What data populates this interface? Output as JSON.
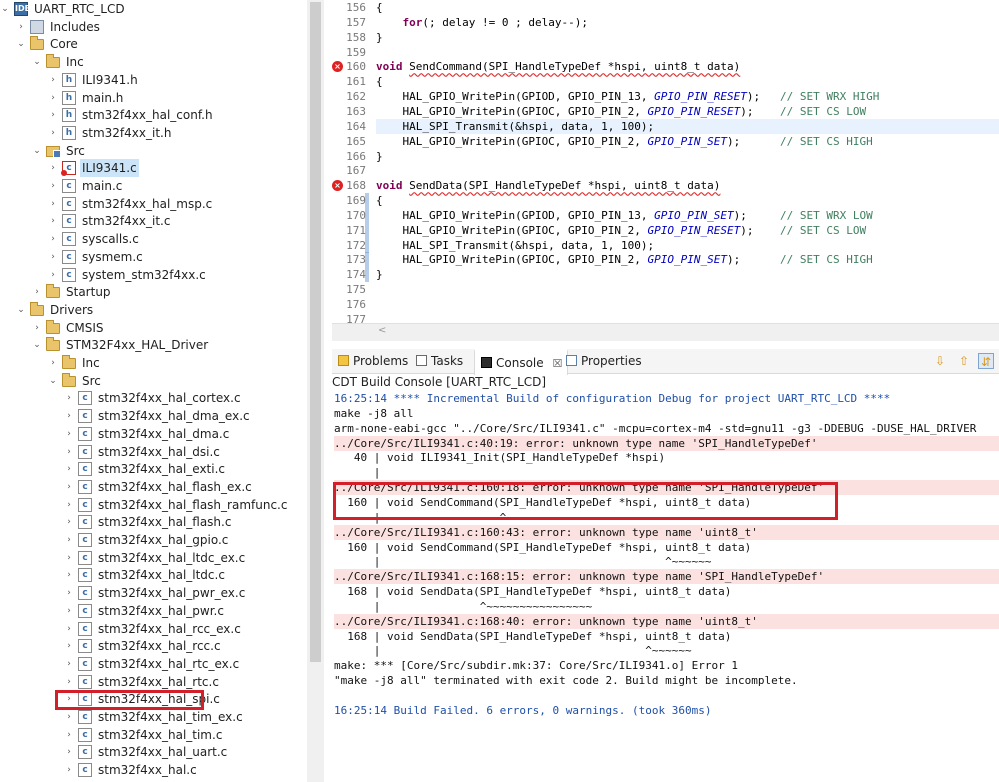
{
  "explorer": {
    "items": [
      {
        "label": "UART_RTC_LCD",
        "depth": 0,
        "twisty": "open",
        "icon": "project-icon"
      },
      {
        "label": "Includes",
        "depth": 1,
        "twisty": "closed",
        "icon": "includes-icon"
      },
      {
        "label": "Core",
        "depth": 1,
        "twisty": "open",
        "icon": "folder-icon"
      },
      {
        "label": "Inc",
        "depth": 2,
        "twisty": "open",
        "icon": "folder-icon"
      },
      {
        "label": "ILI9341.h",
        "depth": 3,
        "twisty": "closed",
        "icon": "h-file-icon"
      },
      {
        "label": "main.h",
        "depth": 3,
        "twisty": "closed",
        "icon": "h-file-icon"
      },
      {
        "label": "stm32f4xx_hal_conf.h",
        "depth": 3,
        "twisty": "closed",
        "icon": "h-file-icon"
      },
      {
        "label": "stm32f4xx_it.h",
        "depth": 3,
        "twisty": "closed",
        "icon": "h-file-icon"
      },
      {
        "label": "Src",
        "depth": 2,
        "twisty": "open",
        "icon": "source-folder-icon"
      },
      {
        "label": "ILI9341.c",
        "depth": 3,
        "twisty": "closed",
        "icon": "c-file-error-icon",
        "selected": true
      },
      {
        "label": "main.c",
        "depth": 3,
        "twisty": "closed",
        "icon": "c-file-icon"
      },
      {
        "label": "stm32f4xx_hal_msp.c",
        "depth": 3,
        "twisty": "closed",
        "icon": "c-file-icon"
      },
      {
        "label": "stm32f4xx_it.c",
        "depth": 3,
        "twisty": "closed",
        "icon": "c-file-icon"
      },
      {
        "label": "syscalls.c",
        "depth": 3,
        "twisty": "closed",
        "icon": "c-file-icon"
      },
      {
        "label": "sysmem.c",
        "depth": 3,
        "twisty": "closed",
        "icon": "c-file-icon"
      },
      {
        "label": "system_stm32f4xx.c",
        "depth": 3,
        "twisty": "closed",
        "icon": "c-file-icon"
      },
      {
        "label": "Startup",
        "depth": 2,
        "twisty": "closed",
        "icon": "folder-icon"
      },
      {
        "label": "Drivers",
        "depth": 1,
        "twisty": "open",
        "icon": "folder-icon"
      },
      {
        "label": "CMSIS",
        "depth": 2,
        "twisty": "closed",
        "icon": "folder-icon"
      },
      {
        "label": "STM32F4xx_HAL_Driver",
        "depth": 2,
        "twisty": "open",
        "icon": "folder-icon"
      },
      {
        "label": "Inc",
        "depth": 3,
        "twisty": "closed",
        "icon": "folder-icon"
      },
      {
        "label": "Src",
        "depth": 3,
        "twisty": "open",
        "icon": "folder-icon"
      },
      {
        "label": "stm32f4xx_hal_cortex.c",
        "depth": 4,
        "twisty": "closed",
        "icon": "c-file-icon"
      },
      {
        "label": "stm32f4xx_hal_dma_ex.c",
        "depth": 4,
        "twisty": "closed",
        "icon": "c-file-icon"
      },
      {
        "label": "stm32f4xx_hal_dma.c",
        "depth": 4,
        "twisty": "closed",
        "icon": "c-file-icon"
      },
      {
        "label": "stm32f4xx_hal_dsi.c",
        "depth": 4,
        "twisty": "closed",
        "icon": "c-file-icon"
      },
      {
        "label": "stm32f4xx_hal_exti.c",
        "depth": 4,
        "twisty": "closed",
        "icon": "c-file-icon"
      },
      {
        "label": "stm32f4xx_hal_flash_ex.c",
        "depth": 4,
        "twisty": "closed",
        "icon": "c-file-icon"
      },
      {
        "label": "stm32f4xx_hal_flash_ramfunc.c",
        "depth": 4,
        "twisty": "closed",
        "icon": "c-file-icon"
      },
      {
        "label": "stm32f4xx_hal_flash.c",
        "depth": 4,
        "twisty": "closed",
        "icon": "c-file-icon"
      },
      {
        "label": "stm32f4xx_hal_gpio.c",
        "depth": 4,
        "twisty": "closed",
        "icon": "c-file-icon"
      },
      {
        "label": "stm32f4xx_hal_ltdc_ex.c",
        "depth": 4,
        "twisty": "closed",
        "icon": "c-file-icon"
      },
      {
        "label": "stm32f4xx_hal_ltdc.c",
        "depth": 4,
        "twisty": "closed",
        "icon": "c-file-icon"
      },
      {
        "label": "stm32f4xx_hal_pwr_ex.c",
        "depth": 4,
        "twisty": "closed",
        "icon": "c-file-icon"
      },
      {
        "label": "stm32f4xx_hal_pwr.c",
        "depth": 4,
        "twisty": "closed",
        "icon": "c-file-icon"
      },
      {
        "label": "stm32f4xx_hal_rcc_ex.c",
        "depth": 4,
        "twisty": "closed",
        "icon": "c-file-icon"
      },
      {
        "label": "stm32f4xx_hal_rcc.c",
        "depth": 4,
        "twisty": "closed",
        "icon": "c-file-icon"
      },
      {
        "label": "stm32f4xx_hal_rtc_ex.c",
        "depth": 4,
        "twisty": "closed",
        "icon": "c-file-icon"
      },
      {
        "label": "stm32f4xx_hal_rtc.c",
        "depth": 4,
        "twisty": "closed",
        "icon": "c-file-icon"
      },
      {
        "label": "stm32f4xx_hal_spi.c",
        "depth": 4,
        "twisty": "closed",
        "icon": "c-file-icon",
        "highlighted": true
      },
      {
        "label": "stm32f4xx_hal_tim_ex.c",
        "depth": 4,
        "twisty": "closed",
        "icon": "c-file-icon"
      },
      {
        "label": "stm32f4xx_hal_tim.c",
        "depth": 4,
        "twisty": "closed",
        "icon": "c-file-icon"
      },
      {
        "label": "stm32f4xx_hal_uart.c",
        "depth": 4,
        "twisty": "closed",
        "icon": "c-file-icon"
      },
      {
        "label": "stm32f4xx_hal.c",
        "depth": 4,
        "twisty": "closed",
        "icon": "c-file-icon"
      }
    ]
  },
  "editor": {
    "lines": [
      {
        "n": "156",
        "code": [
          [
            "",
            "{"
          ]
        ]
      },
      {
        "n": "157",
        "code": [
          [
            "",
            "    "
          ],
          [
            "kw",
            "for"
          ],
          [
            "",
            "(; delay != 0 ; delay--);"
          ]
        ]
      },
      {
        "n": "158",
        "code": [
          [
            "",
            "}"
          ]
        ]
      },
      {
        "n": "159",
        "code": [
          [
            "",
            ""
          ]
        ]
      },
      {
        "n": "160",
        "marker": "error",
        "code": [
          [
            "kw",
            "void"
          ],
          [
            "",
            " "
          ],
          [
            "sq",
            "SendCommand(SPI_HandleTypeDef *hspi, uint8_t data)"
          ]
        ]
      },
      {
        "n": "161",
        "code": [
          [
            "",
            "{"
          ]
        ]
      },
      {
        "n": "162",
        "code": [
          [
            "",
            "    HAL_GPIO_WritePin(GPIOD, GPIO_PIN_13, "
          ],
          [
            "it",
            "GPIO_PIN_RESET"
          ],
          [
            "",
            "); "
          ],
          [
            "cm",
            "  // SET WRX HIGH"
          ]
        ]
      },
      {
        "n": "163",
        "code": [
          [
            "",
            "    HAL_GPIO_WritePin(GPIOC, GPIO_PIN_2, "
          ],
          [
            "it",
            "GPIO_PIN_RESET"
          ],
          [
            "",
            ");  "
          ],
          [
            "cm",
            "  // SET CS LOW"
          ]
        ]
      },
      {
        "n": "164",
        "current": true,
        "code": [
          [
            "",
            "    HAL_SPI_Transmit(&hspi, data, 1, 100);"
          ]
        ]
      },
      {
        "n": "165",
        "code": [
          [
            "",
            "    HAL_GPIO_WritePin(GPIOC, GPIO_PIN_2, "
          ],
          [
            "it",
            "GPIO_PIN_SET"
          ],
          [
            "",
            ");    "
          ],
          [
            "cm",
            "  // SET CS HIGH"
          ]
        ]
      },
      {
        "n": "166",
        "code": [
          [
            "",
            "}"
          ]
        ]
      },
      {
        "n": "167",
        "code": [
          [
            "",
            ""
          ]
        ]
      },
      {
        "n": "168",
        "marker": "error",
        "code": [
          [
            "kw",
            "void"
          ],
          [
            "",
            " "
          ],
          [
            "sq",
            "SendData(SPI_HandleTypeDef *hspi, uint8_t data)"
          ]
        ]
      },
      {
        "n": "169",
        "occ": true,
        "code": [
          [
            "",
            "{"
          ]
        ]
      },
      {
        "n": "170",
        "occ": true,
        "code": [
          [
            "",
            "    HAL_GPIO_WritePin(GPIOD, GPIO_PIN_13, "
          ],
          [
            "it",
            "GPIO_PIN_SET"
          ],
          [
            "",
            ");   "
          ],
          [
            "cm",
            "  // SET WRX LOW"
          ]
        ]
      },
      {
        "n": "171",
        "occ": true,
        "code": [
          [
            "",
            "    HAL_GPIO_WritePin(GPIOC, GPIO_PIN_2, "
          ],
          [
            "it",
            "GPIO_PIN_RESET"
          ],
          [
            "",
            ");  "
          ],
          [
            "cm",
            "  // SET CS LOW"
          ]
        ]
      },
      {
        "n": "172",
        "occ": true,
        "code": [
          [
            "",
            "    HAL_SPI_Transmit(&hspi, data, 1, 100);"
          ]
        ]
      },
      {
        "n": "173",
        "occ": true,
        "code": [
          [
            "",
            "    HAL_GPIO_WritePin(GPIOC, GPIO_PIN_2, "
          ],
          [
            "it",
            "GPIO_PIN_SET"
          ],
          [
            "",
            ");    "
          ],
          [
            "cm",
            "  // SET CS HIGH"
          ]
        ]
      },
      {
        "n": "174",
        "occ": true,
        "code": [
          [
            "",
            "}"
          ]
        ]
      },
      {
        "n": "175",
        "code": [
          [
            "",
            ""
          ]
        ]
      },
      {
        "n": "176",
        "code": [
          [
            "",
            ""
          ]
        ]
      },
      {
        "n": "177",
        "code": [
          [
            "",
            ""
          ]
        ]
      }
    ]
  },
  "console_view": {
    "tabs": [
      {
        "label": "Problems",
        "icon": "problems-icon"
      },
      {
        "label": "Tasks",
        "icon": "tasks-icon"
      },
      {
        "label": "Console",
        "icon": "console-icon",
        "active": true,
        "close": "☒"
      },
      {
        "label": "Properties",
        "icon": "properties-icon"
      }
    ],
    "title": "CDT Build Console [UART_RTC_LCD]",
    "lines": [
      {
        "t": "16:25:14 **** Incremental Build of configuration Debug for project UART_RTC_LCD ****",
        "s": "blue"
      },
      {
        "t": "make -j8 all",
        "s": ""
      },
      {
        "t": "arm-none-eabi-gcc \"../Core/Src/ILI9341.c\" -mcpu=cortex-m4 -std=gnu11 -g3 -DDEBUG -DUSE_HAL_DRIVER",
        "s": ""
      },
      {
        "t": "../Core/Src/ILI9341.c:40:19: error: unknown type name 'SPI_HandleTypeDef'",
        "s": "err"
      },
      {
        "t": "   40 | void ILI9341_Init(SPI_HandleTypeDef *hspi)",
        "s": ""
      },
      {
        "t": "      |",
        "s": ""
      },
      {
        "t": "../Core/Src/ILI9341.c:160:18: error: unknown type name 'SPI_HandleTypeDef'",
        "s": "err"
      },
      {
        "t": "  160 | void SendCommand(SPI_HandleTypeDef *hspi, uint8_t data)",
        "s": ""
      },
      {
        "t": "      |                  ^~~~~~~~~~~~~~~~~",
        "s": ""
      },
      {
        "t": "../Core/Src/ILI9341.c:160:43: error: unknown type name 'uint8_t'",
        "s": "err"
      },
      {
        "t": "  160 | void SendCommand(SPI_HandleTypeDef *hspi, uint8_t data)",
        "s": ""
      },
      {
        "t": "      |                                           ^~~~~~~",
        "s": ""
      },
      {
        "t": "../Core/Src/ILI9341.c:168:15: error: unknown type name 'SPI_HandleTypeDef'",
        "s": "err"
      },
      {
        "t": "  168 | void SendData(SPI_HandleTypeDef *hspi, uint8_t data)",
        "s": ""
      },
      {
        "t": "      |               ^~~~~~~~~~~~~~~~~",
        "s": ""
      },
      {
        "t": "../Core/Src/ILI9341.c:168:40: error: unknown type name 'uint8_t'",
        "s": "err"
      },
      {
        "t": "  168 | void SendData(SPI_HandleTypeDef *hspi, uint8_t data)",
        "s": ""
      },
      {
        "t": "      |                                        ^~~~~~~",
        "s": ""
      },
      {
        "t": "make: *** [Core/Src/subdir.mk:37: Core/Src/ILI9341.o] Error 1",
        "s": ""
      },
      {
        "t": "\"make -j8 all\" terminated with exit code 2. Build might be incomplete.",
        "s": ""
      },
      {
        "t": "",
        "s": ""
      },
      {
        "t": "16:25:14 Build Failed. 6 errors, 0 warnings. (took 360ms)",
        "s": "blue"
      }
    ]
  },
  "colors": {
    "highlight_box": "#d21f2a",
    "keyword": "#7f0055",
    "enum_const": "#0000c0",
    "comment": "#3f7f5f",
    "console_info": "#1f4fa8",
    "error_row_bg": "#fbe2e0"
  }
}
